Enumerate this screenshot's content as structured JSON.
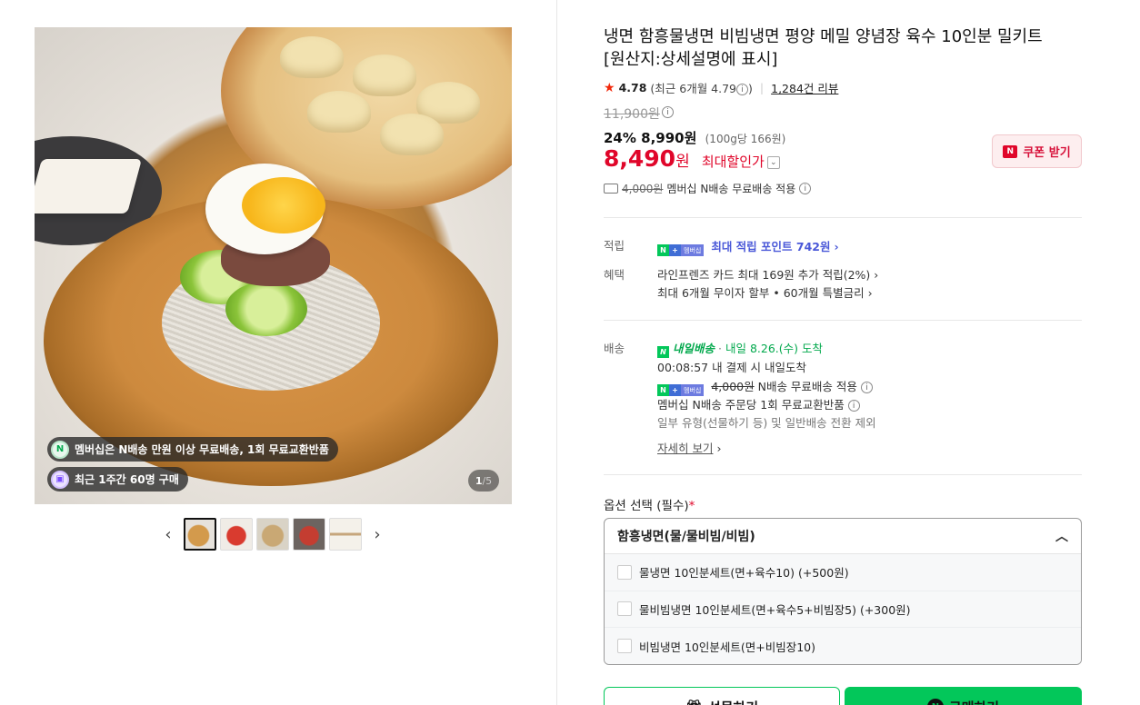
{
  "gallery": {
    "badges": {
      "membership": "멤버십은 N배송 만원 이상 무료배송, 1회 무료교환반품",
      "recent": "최근 1주간 60명 구매"
    },
    "counter_current": "1",
    "counter_total": "/5"
  },
  "product": {
    "title_line1": "냉면 함흥물냉면 비빔냉면 평양 메밀 양념장 육수 10인분 밀키트",
    "title_line2": "[원산지:상세설명에 표시]",
    "rating": "4.78",
    "rating_recent": "(최근 6개월 4.79",
    "rating_recent_end": ")",
    "review_count": "1,284건 리뷰",
    "original_price": "11,900원",
    "discount_rate": "24%",
    "sale_price": "8,990원",
    "unit_price": "(100g당 166원)",
    "max_discount_price": "8,490",
    "won": "원",
    "max_discount_label": "최대할인가",
    "coupon_button": "쿠폰 받기",
    "shipping_fee_struck": "4,000원",
    "shipping_note": "멤버십 N배송 무료배송 적용"
  },
  "benefits": {
    "points_label": "적립",
    "points_text": "최대 적립 포인트 742원",
    "benefit_label": "혜택",
    "benefit_line1": "라인프렌즈 카드 최대 169원 추가 적립(2%)",
    "benefit_line2": "최대 6개월 무이자 할부 • 60개월 특별금리"
  },
  "delivery": {
    "label": "배송",
    "nextday_tag": "내일배송",
    "arrival": "내일 8.26.(수) 도착",
    "countdown": "00:08:57  내 결제 시 내일도착",
    "fee_struck": "4,000원",
    "fee_note": "N배송 무료배송 적용",
    "return_note": "멤버십 N배송 주문당 1회 무료교환반품",
    "exclusion_note": "일부 유형(선물하기 등) 및 일반배송 전환 제외",
    "more_link": "자세히 보기"
  },
  "options": {
    "label": "옵션 선택 (필수)",
    "required_mark": "*",
    "selected": "함흥냉면(물/물비빔/비빔)",
    "items": [
      "물냉면 10인분세트(면+육수10) (+500원)",
      "물비빔냉면 10인분세트(면+육수5+비빔장5) (+300원)",
      "비빔냉면 10인분세트(면+비빔장10)"
    ]
  },
  "actions": {
    "gift": "선물하기",
    "buy": "구매하기"
  },
  "colors": {
    "accent_green": "#03c75a",
    "price_red": "#e0062a",
    "point_blue": "#4a58d8"
  }
}
